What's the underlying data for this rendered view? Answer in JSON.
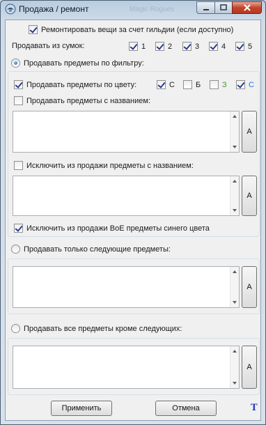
{
  "window": {
    "title": "Продажа / ремонт",
    "ghost_title": "Magic Rogues"
  },
  "colors": {
    "green_label": "#3aa02a",
    "blue_label": "#2a6fd6",
    "accent": "#1f5fb8"
  },
  "repair": {
    "label": "Ремонтировать вещи за счет гильдии (если доступно)",
    "checked": true
  },
  "bags": {
    "label": "Продавать из сумок:",
    "items": [
      {
        "label": "1",
        "checked": true
      },
      {
        "label": "2",
        "checked": true
      },
      {
        "label": "3",
        "checked": true
      },
      {
        "label": "4",
        "checked": true
      },
      {
        "label": "5",
        "checked": true
      }
    ]
  },
  "filter": {
    "radio_label": "Продавать предметы по фильтру:",
    "selected": true,
    "by_color": {
      "label": "Продавать предметы по цвету:",
      "checked": true,
      "colors": [
        {
          "label": "С",
          "checked": true
        },
        {
          "label": "Б",
          "checked": false
        },
        {
          "label": "З",
          "checked": false
        },
        {
          "label": "С",
          "checked": true
        }
      ]
    },
    "by_name": {
      "label": "Продавать предметы с названием:",
      "checked": false,
      "button": "А"
    },
    "exclude_name": {
      "label": "Исключить из продажи предметы с названием:",
      "checked": false,
      "button": "А"
    },
    "exclude_boe": {
      "label": "Исключить из продажи BoE предметы синего цвета",
      "checked": true
    }
  },
  "only_items": {
    "radio_label": "Продавать только следующие предметы:",
    "selected": false,
    "button": "А"
  },
  "all_except": {
    "radio_label": "Продавать все предметы кроме следующих:",
    "selected": false,
    "button": "А"
  },
  "footer": {
    "apply": "Применить",
    "cancel": "Отмена",
    "t_icon": "T"
  }
}
